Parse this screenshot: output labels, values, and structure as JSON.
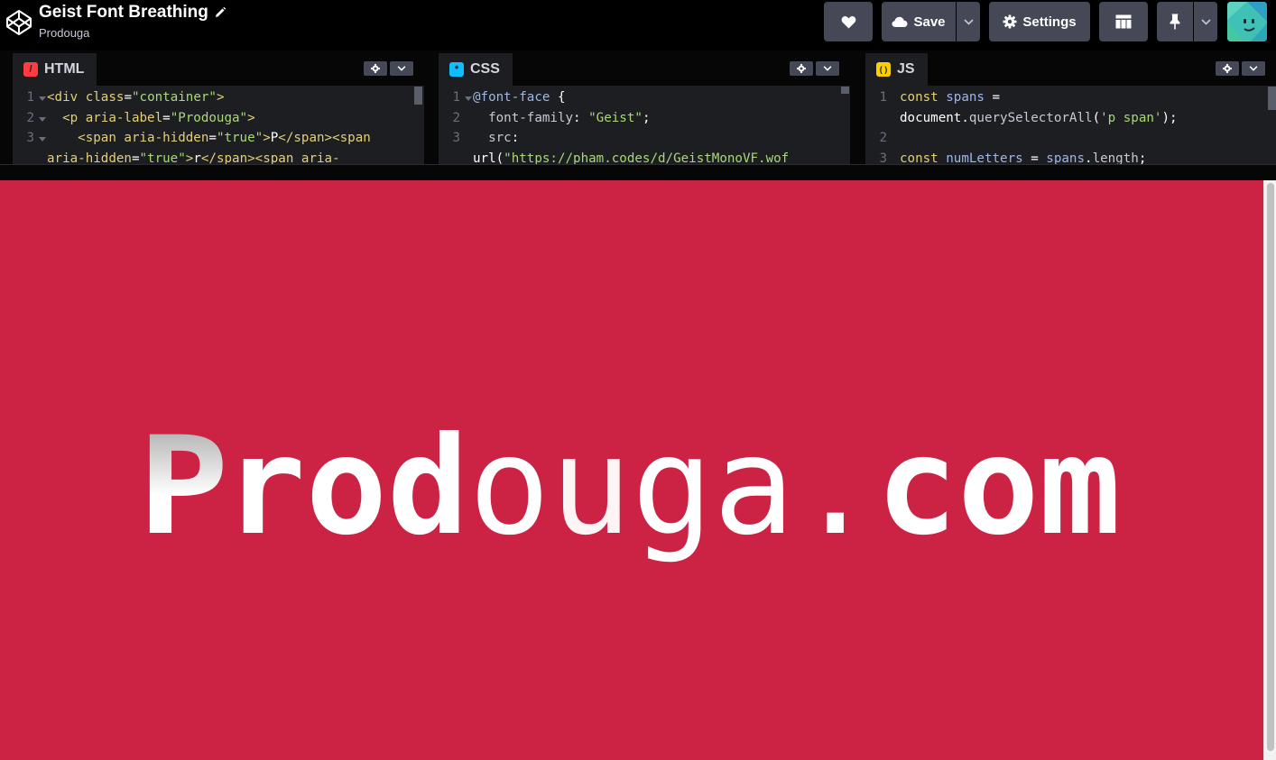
{
  "header": {
    "pen_title": "Geist Font Breathing",
    "author": "Prodouga",
    "save_label": "Save",
    "settings_label": "Settings"
  },
  "editors": {
    "html": {
      "label": "HTML",
      "icon": "/",
      "color": "#ff3c41",
      "lines": [
        {
          "num": "1",
          "fold": true,
          "parts": [
            {
              "t": "<div ",
              "c": "tk-tag"
            },
            {
              "t": "class",
              "c": "tk-attr"
            },
            {
              "t": "=",
              "c": "tk-plain"
            },
            {
              "t": "\"container\"",
              "c": "tk-str"
            },
            {
              "t": ">",
              "c": "tk-tag"
            }
          ]
        },
        {
          "num": "2",
          "fold": true,
          "parts": [
            {
              "t": "  <p ",
              "c": "tk-tag"
            },
            {
              "t": "aria-label",
              "c": "tk-attr"
            },
            {
              "t": "=",
              "c": "tk-plain"
            },
            {
              "t": "\"Prodouga\"",
              "c": "tk-str"
            },
            {
              "t": ">",
              "c": "tk-tag"
            }
          ]
        },
        {
          "num": "3",
          "fold": true,
          "parts": [
            {
              "t": "    <span ",
              "c": "tk-tag"
            },
            {
              "t": "aria-hidden",
              "c": "tk-attr"
            },
            {
              "t": "=",
              "c": "tk-plain"
            },
            {
              "t": "\"true\"",
              "c": "tk-str"
            },
            {
              "t": ">",
              "c": "tk-tag"
            },
            {
              "t": "P",
              "c": "tk-plain"
            },
            {
              "t": "</span><span",
              "c": "tk-tag"
            }
          ]
        },
        {
          "num": "",
          "fold": false,
          "parts": [
            {
              "t": "aria-hidden",
              "c": "tk-attr"
            },
            {
              "t": "=",
              "c": "tk-plain"
            },
            {
              "t": "\"true\"",
              "c": "tk-str"
            },
            {
              "t": ">",
              "c": "tk-tag"
            },
            {
              "t": "r",
              "c": "tk-plain"
            },
            {
              "t": "</span><span ",
              "c": "tk-tag"
            },
            {
              "t": "aria-",
              "c": "tk-attr"
            }
          ]
        }
      ]
    },
    "css": {
      "label": "CSS",
      "icon": "*",
      "color": "#0ebeff",
      "lines": [
        {
          "num": "1",
          "fold": true,
          "parts": [
            {
              "t": "@font-face",
              "c": "tk-var"
            },
            {
              "t": " {",
              "c": "tk-plain"
            }
          ]
        },
        {
          "num": "2",
          "fold": false,
          "parts": [
            {
              "t": "  font-family",
              "c": "tk-prop"
            },
            {
              "t": ": ",
              "c": "tk-plain"
            },
            {
              "t": "\"Geist\"",
              "c": "tk-str"
            },
            {
              "t": ";",
              "c": "tk-plain"
            }
          ]
        },
        {
          "num": "3",
          "fold": false,
          "parts": [
            {
              "t": "  src",
              "c": "tk-prop"
            },
            {
              "t": ":",
              "c": "tk-plain"
            }
          ]
        },
        {
          "num": "",
          "fold": false,
          "parts": [
            {
              "t": "url(",
              "c": "tk-plain"
            },
            {
              "t": "\"https://pham.codes/d/GeistMonoVF.wof",
              "c": "tk-str"
            }
          ]
        }
      ]
    },
    "js": {
      "label": "JS",
      "icon": "( )",
      "color": "#fcd000",
      "lines": [
        {
          "num": "1",
          "fold": false,
          "parts": [
            {
              "t": "const ",
              "c": "tk-kw"
            },
            {
              "t": "spans",
              "c": "tk-var"
            },
            {
              "t": " =",
              "c": "tk-plain"
            }
          ]
        },
        {
          "num": "",
          "fold": false,
          "parts": [
            {
              "t": "document",
              "c": "tk-plain"
            },
            {
              "t": ".",
              "c": "tk-plain"
            },
            {
              "t": "querySelectorAll",
              "c": "tk-prop"
            },
            {
              "t": "(",
              "c": "tk-plain"
            },
            {
              "t": "'p span'",
              "c": "tk-str"
            },
            {
              "t": ");",
              "c": "tk-plain"
            }
          ]
        },
        {
          "num": "2",
          "fold": false,
          "parts": []
        },
        {
          "num": "3",
          "fold": false,
          "parts": [
            {
              "t": "const ",
              "c": "tk-kw"
            },
            {
              "t": "numLetters",
              "c": "tk-var"
            },
            {
              "t": " = ",
              "c": "tk-plain"
            },
            {
              "t": "spans",
              "c": "tk-var"
            },
            {
              "t": ".",
              "c": "tk-plain"
            },
            {
              "t": "length",
              "c": "tk-prop"
            },
            {
              "t": ";",
              "c": "tk-plain"
            }
          ]
        }
      ]
    }
  },
  "preview": {
    "background": "#cc2244",
    "text_chars": [
      "P",
      "r",
      "o",
      "d",
      "o",
      "u",
      "g",
      "a",
      ".",
      "c",
      "o",
      "m"
    ]
  }
}
